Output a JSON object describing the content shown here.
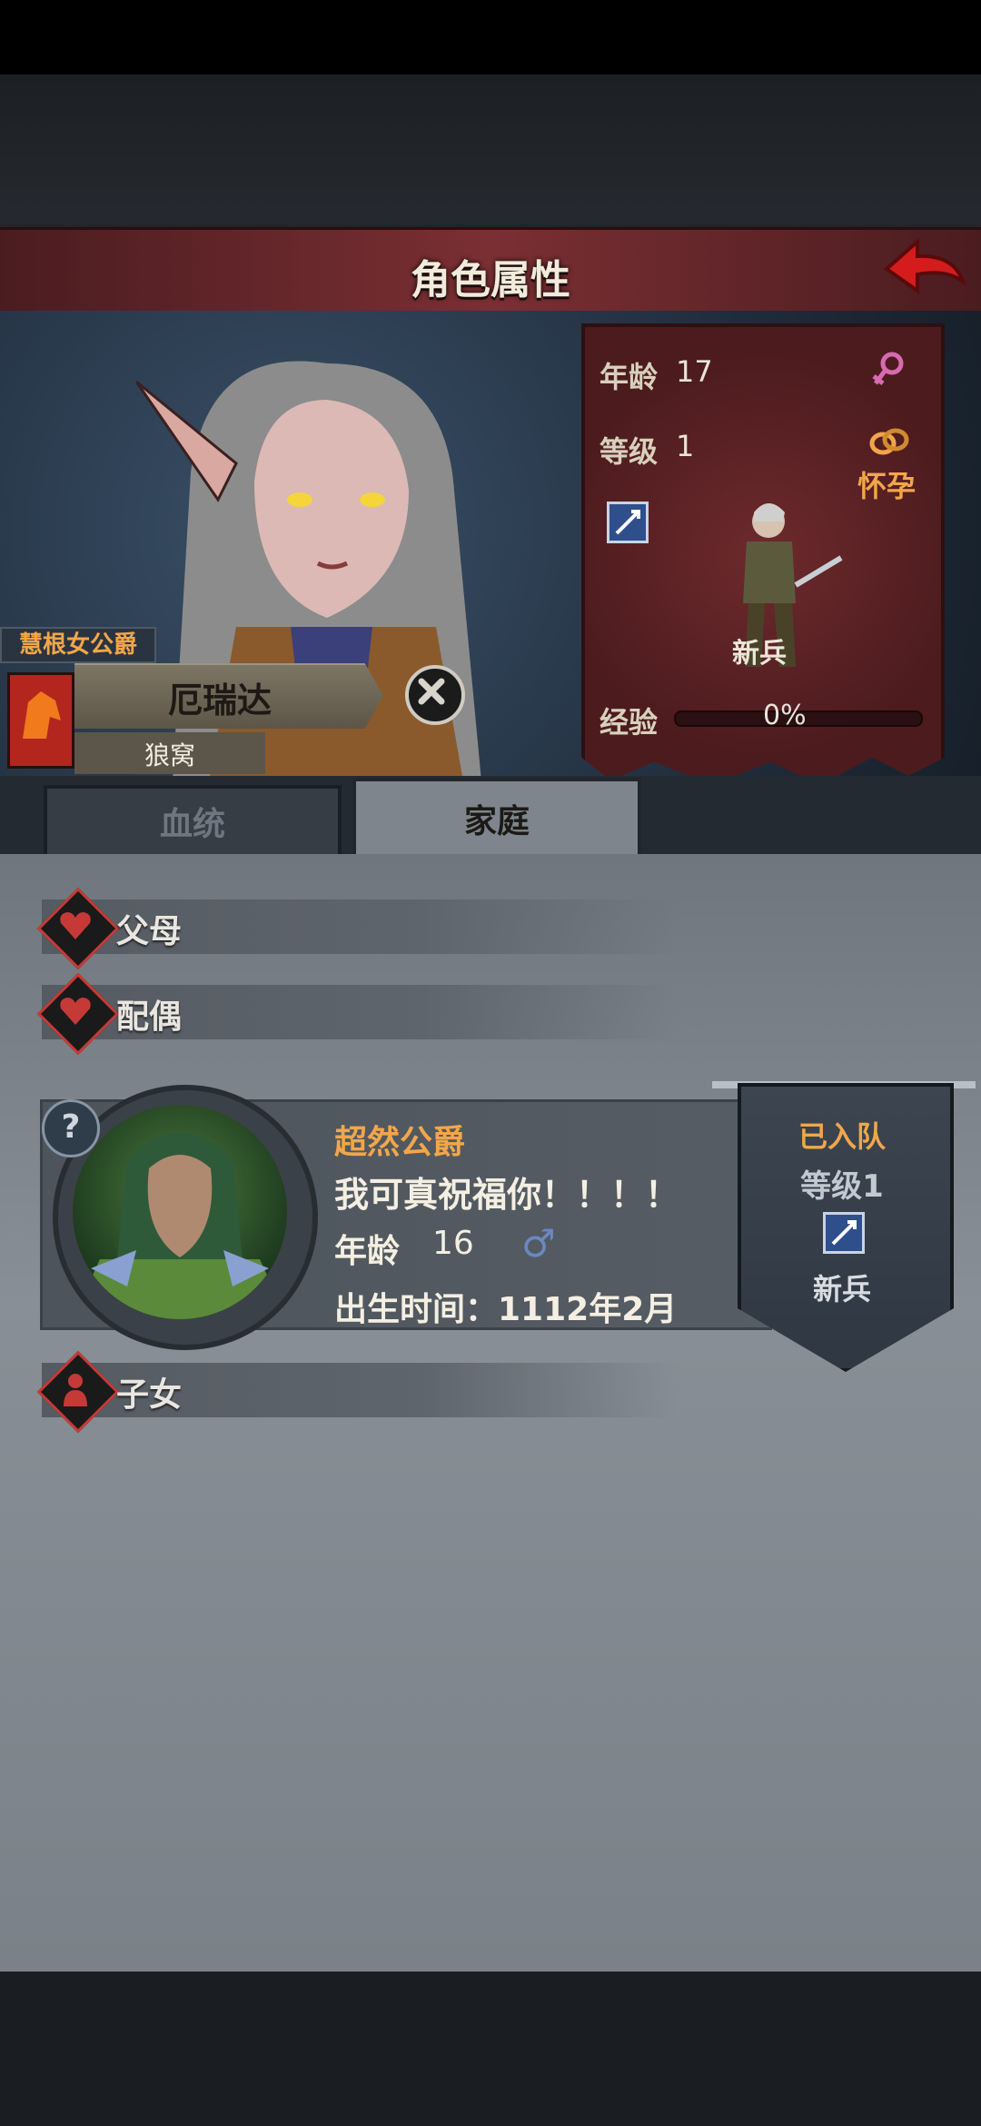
{
  "header": {
    "title": "角色属性"
  },
  "character": {
    "title": "慧根女公爵",
    "name": "厄瑞达",
    "house": "狼窝",
    "age_label": "年龄",
    "age": "17",
    "level_label": "等级",
    "level": "1",
    "status": "怀孕",
    "class": "新兵",
    "xp_label": "经验",
    "xp_percent": "0%"
  },
  "tabs": [
    {
      "label": "血统"
    },
    {
      "label": "家庭"
    }
  ],
  "family": {
    "parents_label": "父母",
    "spouse_label": "配偶",
    "children_label": "子女",
    "spouse": {
      "title": "超然公爵",
      "quote": "我可真祝福你！！！！",
      "age_label": "年龄",
      "age": "16",
      "birth": "出生时间：1112年2月",
      "joined": "已入队",
      "level": "等级1",
      "class": "新兵"
    }
  },
  "colors": {
    "accent_orange": "#f2a64a",
    "title_red": "#7a2f33",
    "panel_red": "#6d2a2d"
  }
}
